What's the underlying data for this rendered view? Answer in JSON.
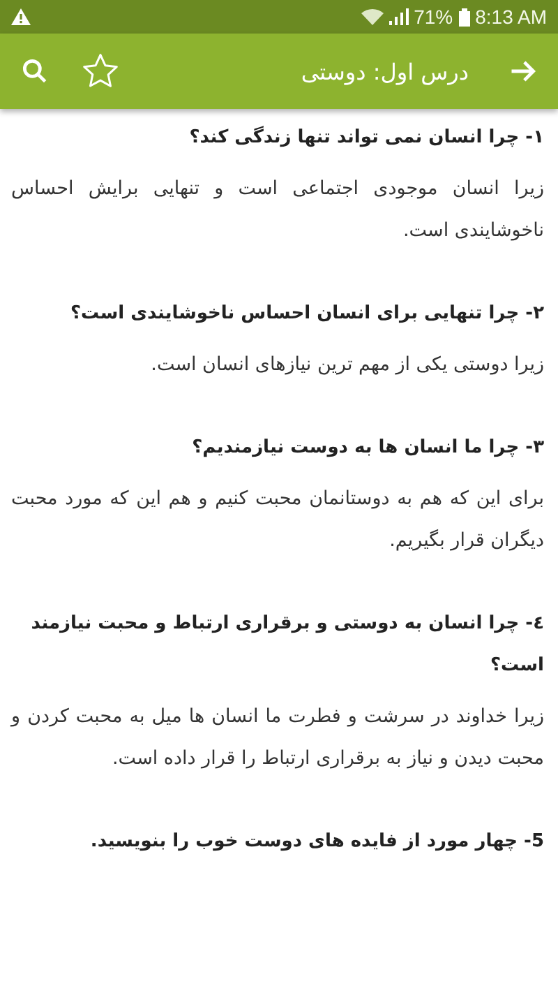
{
  "status_bar": {
    "battery": "71%",
    "time": "8:13 AM"
  },
  "toolbar": {
    "title": "درس اول: دوستی",
    "favorite": false
  },
  "items": [
    {
      "kind": "question",
      "text": "۱- چرا انسان نمی تواند تنها زندگی کند؟"
    },
    {
      "kind": "answer",
      "text": "زیرا انسان موجودی اجتماعی است و تنهایی برایش احساس ناخوشایندی است."
    },
    {
      "kind": "question",
      "text": "۲- چرا تنهایی برای انسان احساس ناخوشایندی است؟"
    },
    {
      "kind": "answer",
      "text": "زیرا دوستی یکی از مهم ترین نیازهای انسان است."
    },
    {
      "kind": "question",
      "text": "۳- چرا ما انسان ها به دوست نیازمندیم؟"
    },
    {
      "kind": "answer",
      "text": "برای این که هم به دوستانمان محبت کنیم و هم این که مورد محبت دیگران قرار بگیریم."
    },
    {
      "kind": "question",
      "text": "٤- چرا انسان به دوستی و برقراری ارتباط و محبت نیازمند است؟"
    },
    {
      "kind": "answer",
      "text": "زیرا خداوند در سرشت و فطرت ما انسان ها میل به محبت کردن و محبت دیدن و نیاز به برقراری ارتباط را قرار داده است."
    },
    {
      "kind": "question",
      "text": "5- چهار مورد از فایده های دوست خوب را بنویسید."
    }
  ]
}
